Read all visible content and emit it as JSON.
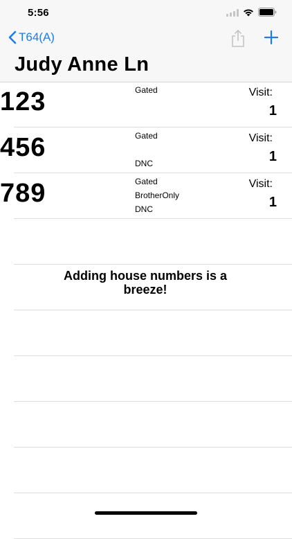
{
  "status_bar": {
    "time": "5:56"
  },
  "nav": {
    "back_label": "T64(A)"
  },
  "page": {
    "title": "Judy Anne Ln"
  },
  "houses": [
    {
      "number": "123",
      "tags": [
        "Gated"
      ],
      "visit_label": "Visit:",
      "visits": "1"
    },
    {
      "number": "456",
      "tags": [
        "Gated",
        "DNC"
      ],
      "visit_label": "Visit:",
      "visits": "1"
    },
    {
      "number": "789",
      "tags": [
        "Gated",
        "BrotherOnly",
        "DNC"
      ],
      "visit_label": "Visit:",
      "visits": "1"
    }
  ],
  "promo": {
    "line1": "Adding house numbers is a",
    "line2": "breeze!"
  },
  "colors": {
    "accent": "#1a7cf0",
    "header_bg": "#f7f7f8"
  }
}
